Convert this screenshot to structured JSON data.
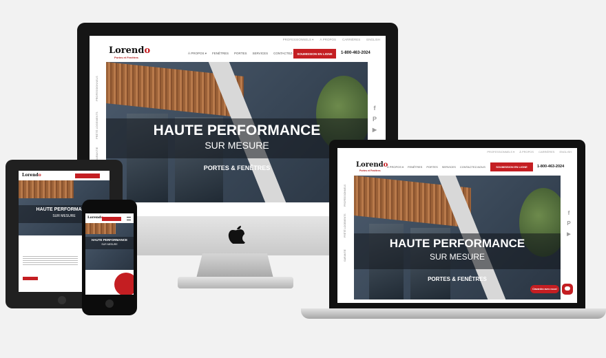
{
  "site": {
    "logo_text_main": "Lorend",
    "logo_text_o": "o",
    "logo_sub": "Portes et Fenêtres",
    "top_nav": [
      "PROFESSIONNELS ▾",
      "À PROPOS",
      "CARRIÈRES",
      "ENGLISH"
    ],
    "main_nav": [
      "À PROPOS ▾",
      "FENÊTRES",
      "PORTES",
      "SERVICES",
      "CONTACTEZ-NOUS"
    ],
    "cta_label": "SOUMISSION EN LIGNE",
    "phone": "1-800-463-2024",
    "hero_title": "HAUTE PERFORMANCE",
    "hero_subtitle": "SUR MESURE",
    "hero_tagline": "PORTES & FENÊTRES",
    "side_tabs": [
      "PROFESSIONNELS",
      "PRÉTÉ LOGEMENTS",
      "GARANTIE"
    ],
    "social": [
      "f",
      "P",
      "▶"
    ],
    "chat_label": "Clavardez avec nous!"
  },
  "colors": {
    "brand_red": "#c41e22",
    "page_bg": "#f2f2f2",
    "hero_band": "#12161c"
  },
  "devices": {
    "desktop_icon": "apple-logo-icon",
    "tablet_icon": "home-button-icon",
    "phone_icon": "home-button-icon"
  }
}
